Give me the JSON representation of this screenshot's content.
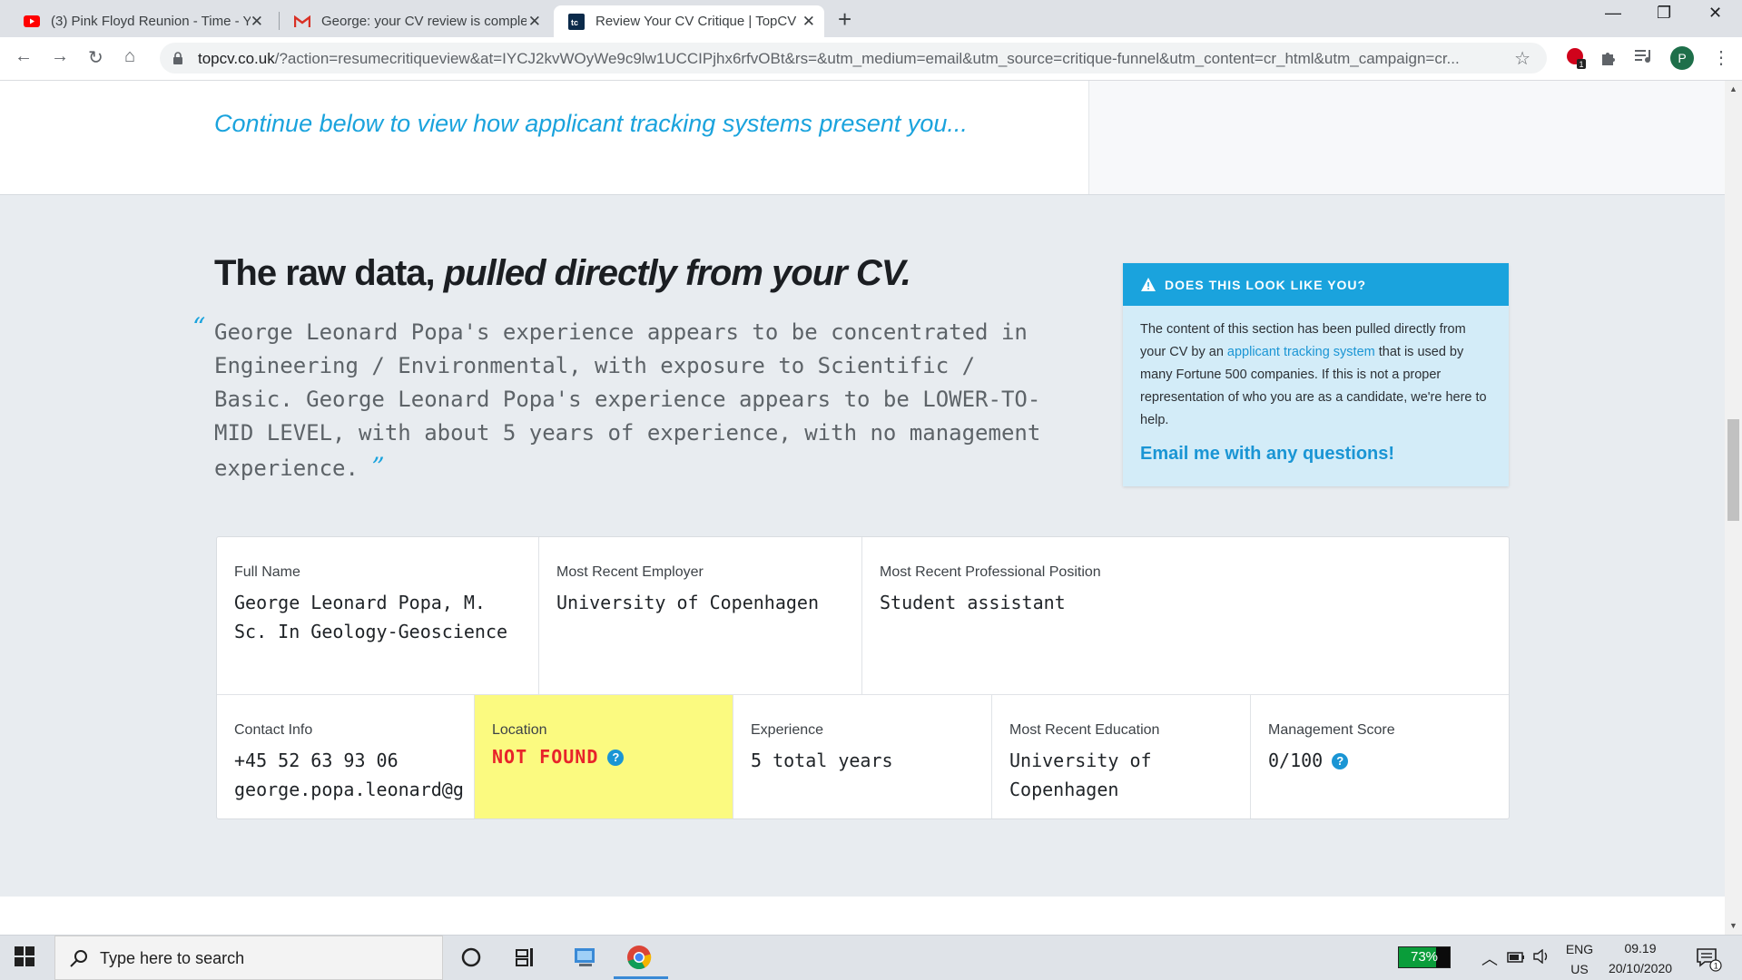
{
  "browser": {
    "tabs": [
      {
        "title": "(3) Pink Floyd Reunion - Time - Y",
        "icon": "youtube-icon",
        "active": false
      },
      {
        "title": "George: your CV review is comple",
        "icon": "gmail-icon",
        "active": false
      },
      {
        "title": "Review Your CV Critique | TopCV",
        "icon": "topcv-icon",
        "active": true
      }
    ],
    "new_tab": "+",
    "url_host": "topcv.co.uk",
    "url_rest": "/?action=resumecritiqueview&at=IYCJ2kvWOyWe9c9lw1UCCIPjhx6rfvOBt&rs=&utm_medium=email&utm_source=critique-funnel&utm_content=cr_html&utm_campaign=cr...",
    "profile_initial": "P",
    "ext_badge": "1"
  },
  "page": {
    "continue_text": "Continue below to view how applicant tracking systems present you...",
    "raw_title_plain": "The raw data, ",
    "raw_title_em": "pulled directly from your CV.",
    "quote_open": "“",
    "quote_close": "”",
    "quote_text": "George Leonard Popa's experience appears to be concentrated in Engineering / Environmental, with exposure to Scientific / Basic. George Leonard Popa's experience appears to be LOWER-TO-MID LEVEL, with about 5 years of experience, with no management experience.",
    "callout": {
      "heading": "DOES THIS LOOK LIKE YOU?",
      "body_pre": "The content of this section has been pulled directly from your CV by an ",
      "body_link": "applicant tracking system",
      "body_post": " that is used by many Fortune 500 companies. If this is not a proper representation of who you are as a candidate, we're here to help.",
      "email_link": "Email me with any questions!"
    },
    "fields": {
      "full_name_label": "Full Name",
      "full_name_value": "George Leonard Popa, M. Sc. In Geology-Geoscience",
      "employer_label": "Most Recent Employer",
      "employer_value": "University of Copenhagen",
      "position_label": "Most Recent Professional Position",
      "position_value": "Student assistant",
      "contact_label": "Contact Info",
      "contact_phone": "+45 52 63 93 06",
      "contact_email": "george.popa.leonard@g",
      "location_label": "Location",
      "location_value": "NOT FOUND",
      "experience_label": "Experience",
      "experience_value": "5 total years",
      "education_label": "Most Recent Education",
      "education_value": "University of Copenhagen",
      "management_label": "Management Score",
      "management_value": "0/100",
      "help_glyph": "?"
    }
  },
  "taskbar": {
    "search_placeholder": "Type here to search",
    "battery_percent": "73%",
    "battery_level": 0.73,
    "lang_top": "ENG",
    "lang_bottom": "US",
    "time": "09.19",
    "date": "20/10/2020",
    "notif_count": "1"
  },
  "colors": {
    "accent": "#1aa3dd",
    "warning_bg": "#fbfa80",
    "not_found": "#e8232a"
  }
}
